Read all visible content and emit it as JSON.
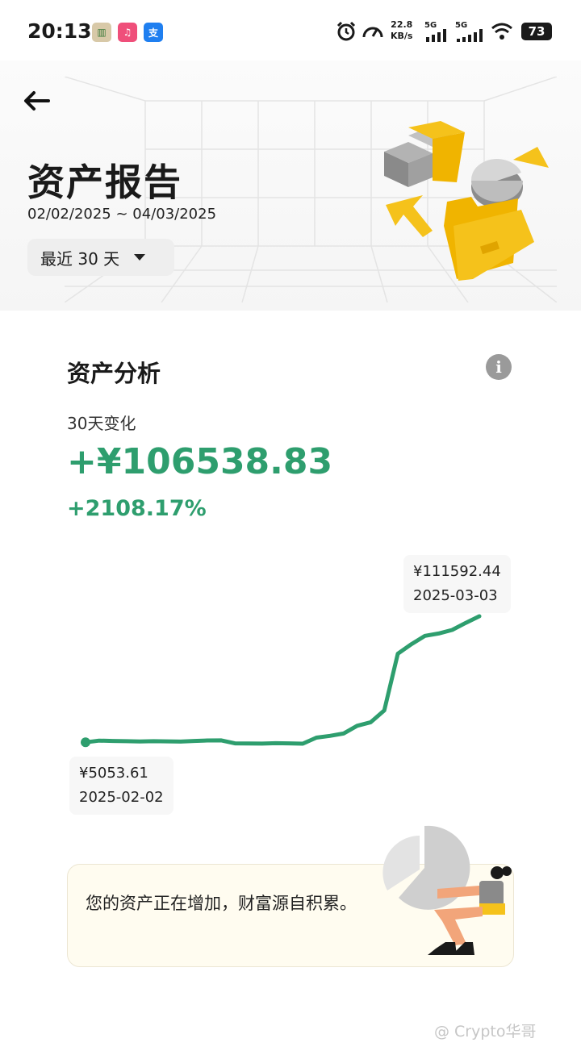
{
  "status_bar": {
    "time": "20:13",
    "speed_value": "22.8",
    "speed_unit": "KB/s",
    "sim1": "5G",
    "sim2": "5G",
    "battery": "73"
  },
  "header": {
    "title": "资产报告",
    "date_range": "02/02/2025 ~ 04/03/2025",
    "period_selector": "最近 30 天"
  },
  "analysis": {
    "section_title": "资产分析",
    "change_label": "30天变化",
    "change_amount": "+¥106538.83",
    "change_percent": "+2108.17%",
    "start_tooltip": {
      "value": "¥5053.61",
      "date": "2025-02-02"
    },
    "end_tooltip": {
      "value": "¥111592.44",
      "date": "2025-03-03"
    }
  },
  "message": {
    "text": "您的资产正在增加，财富源自积累。"
  },
  "watermark": "@ Crypto华哥",
  "colors": {
    "accent_green": "#2e9e6e",
    "illustration_yellow": "#f5c21b"
  },
  "chart_data": {
    "type": "line",
    "x": [
      "2025-02-02",
      "2025-02-03",
      "2025-02-04",
      "2025-02-05",
      "2025-02-06",
      "2025-02-07",
      "2025-02-08",
      "2025-02-09",
      "2025-02-10",
      "2025-02-11",
      "2025-02-12",
      "2025-02-13",
      "2025-02-14",
      "2025-02-15",
      "2025-02-16",
      "2025-02-17",
      "2025-02-18",
      "2025-02-19",
      "2025-02-20",
      "2025-02-21",
      "2025-02-22",
      "2025-02-23",
      "2025-02-24",
      "2025-02-25",
      "2025-02-26",
      "2025-02-27",
      "2025-02-28",
      "2025-03-01",
      "2025-03-02",
      "2025-03-03"
    ],
    "series": [
      {
        "values": [
          5053.61,
          6500,
          6200,
          6000,
          5800,
          6000,
          5900,
          5700,
          6200,
          6600,
          6700,
          4200,
          4100,
          4000,
          4300,
          4200,
          3900,
          9000,
          10500,
          12500,
          19000,
          22000,
          32000,
          80000,
          88000,
          95000,
          97000,
          100000,
          106000,
          111592.44
        ]
      }
    ],
    "start_label": {
      "value": "¥5053.61",
      "date": "2025-02-02"
    },
    "end_label": {
      "value": "¥111592.44",
      "date": "2025-03-03"
    }
  }
}
